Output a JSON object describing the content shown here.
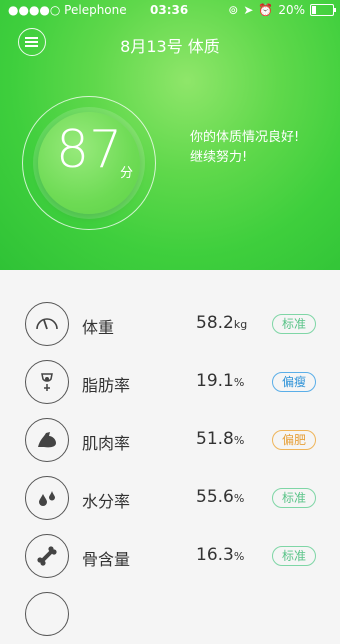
{
  "status": {
    "carrier": "●●●●○ Pelephone",
    "time": "03:36",
    "battery": "20%",
    "battery_level": 0.2
  },
  "header": {
    "title": "8月13号 体质"
  },
  "score": {
    "value": "87",
    "unit": "分",
    "message_line1": "你的体质情况良好!",
    "message_line2": "继续努力!"
  },
  "metrics": [
    {
      "label": "体重",
      "value": "58.2",
      "unit": "kg",
      "status": "标准",
      "icon": "scale-gauge-icon",
      "status_color": "#5bc489"
    },
    {
      "label": "脂肪率",
      "value": "19.1",
      "unit": "%",
      "status": "偏瘦",
      "icon": "fat-drop-icon",
      "status_color": "#2f93d8"
    },
    {
      "label": "肌肉率",
      "value": "51.8",
      "unit": "%",
      "status": "偏肥",
      "icon": "muscle-arm-icon",
      "status_color": "#e6a03a"
    },
    {
      "label": "水分率",
      "value": "55.6",
      "unit": "%",
      "status": "标准",
      "icon": "water-drops-icon",
      "status_color": "#5bc489"
    },
    {
      "label": "骨含量",
      "value": "16.3",
      "unit": "%",
      "status": "标准",
      "icon": "bone-icon",
      "status_color": "#5bc489"
    }
  ]
}
